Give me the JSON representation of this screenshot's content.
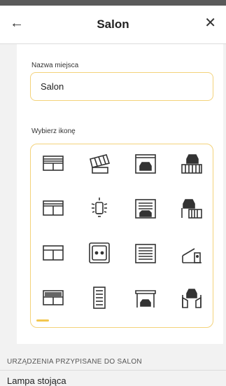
{
  "header": {
    "title": "Salon",
    "back_icon": "arrow-left-icon",
    "close_icon": "close-icon"
  },
  "form": {
    "name_label": "Nazwa miejsca",
    "name_value": "Salon",
    "icon_label": "Wybierz ikonę"
  },
  "icons": [
    "shutter-icon",
    "awning-icon",
    "garage-car-icon",
    "car-gate-icon",
    "shutter-window-icon",
    "bulb-icon",
    "garage-door-icon",
    "car-fence-gate-icon",
    "window-icon",
    "socket-icon",
    "garage-closed-icon",
    "barrier-icon",
    "blind-icon",
    "door-icon",
    "carport-icon",
    "car-gate-open-icon"
  ],
  "section": {
    "assigned_label": "URZĄDZENIA PRZYPISANE DO SALON",
    "items": [
      "Lampa stojąca"
    ]
  },
  "colors": {
    "accent": "#f3d27a",
    "scroll_accent": "#f3c74f"
  }
}
